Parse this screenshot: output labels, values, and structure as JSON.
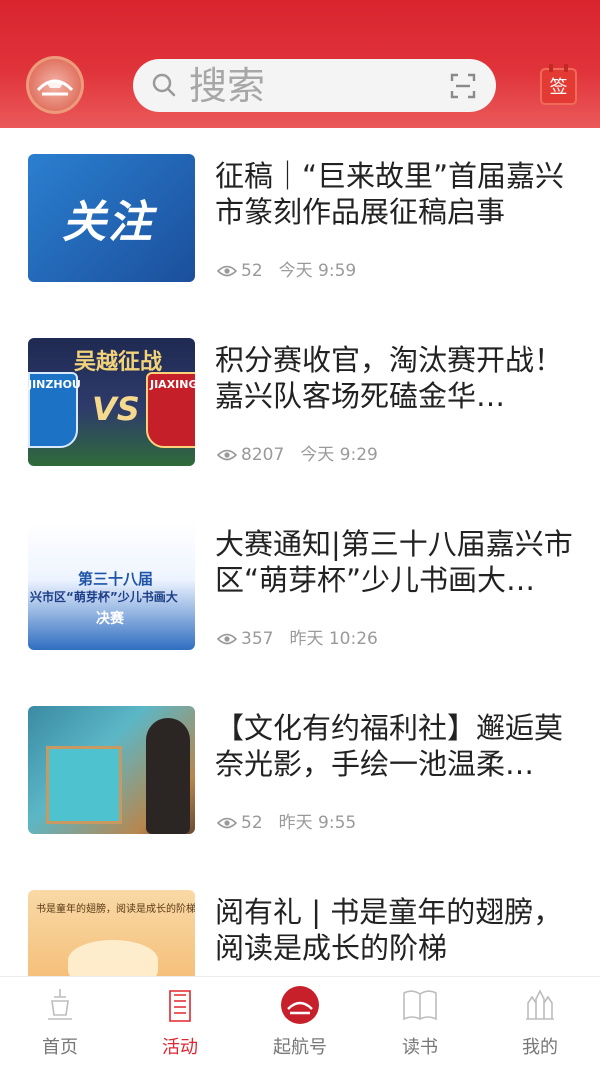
{
  "header": {
    "search_placeholder": "搜索",
    "checkin_label": "签",
    "colors": {
      "brand": "#e0262f",
      "header_bg": "#d9242e"
    }
  },
  "news": [
    {
      "title": "征稿｜“巨来故里”首届嘉兴市篆刻作品展征稿启事",
      "views": "52",
      "time": "今天 9:59",
      "thumb_text": "关注"
    },
    {
      "title": "积分赛收官，淘汰赛开战！嘉兴队客场死磕金华…",
      "views": "8207",
      "time": "今天 9:29",
      "thumb_text": "吴越征战",
      "thumb_left": "JINZHOU",
      "thumb_vs": "VS",
      "thumb_right": "JIAXING"
    },
    {
      "title": "大赛通知|第三十八届嘉兴市区“萌芽杯”少儿书画大…",
      "views": "357",
      "time": "昨天 10:26",
      "thumb_line1": "第三十八届",
      "thumb_line2": "兴市区“萌芽杯”少儿书画大",
      "thumb_line3": "决赛"
    },
    {
      "title": "【文化有约福利社】邂逅莫奈光影，手绘一池温柔…",
      "views": "52",
      "time": "昨天 9:55"
    },
    {
      "title": "阅有礼 | 书是童年的翅膀，阅读是成长的阶梯",
      "thumb_text": "书是童年的翅膀，阅读是成长的阶梯"
    }
  ],
  "tabs": [
    {
      "label": "首页",
      "icon": "home-icon",
      "active": false
    },
    {
      "label": "活动",
      "icon": "activity-icon",
      "active": true
    },
    {
      "label": "起航号",
      "icon": "qihang-icon",
      "active": false
    },
    {
      "label": "读书",
      "icon": "book-icon",
      "active": false
    },
    {
      "label": "我的",
      "icon": "profile-icon",
      "active": false
    }
  ]
}
